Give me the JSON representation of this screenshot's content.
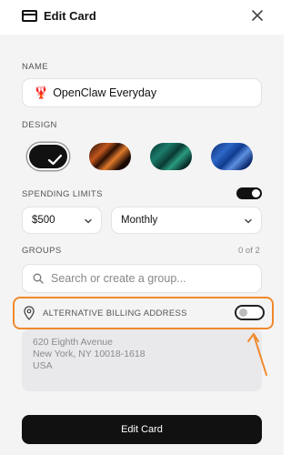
{
  "header": {
    "title": "Edit Card"
  },
  "name_section": {
    "label": "NAME",
    "value": "OpenClaw Everyday",
    "emoji": "🦞"
  },
  "design_section": {
    "label": "DESIGN",
    "swatches": [
      {
        "name": "black",
        "colors": [
          "#111111"
        ],
        "selected": true
      },
      {
        "name": "copper",
        "colors": [
          "#1a0904",
          "#c2561d",
          "#e07a2b"
        ],
        "selected": false
      },
      {
        "name": "emerald",
        "colors": [
          "#06302c",
          "#1b7c6a",
          "#2a9a7f"
        ],
        "selected": false
      },
      {
        "name": "sapphire",
        "colors": [
          "#0b2a6e",
          "#2f67c7",
          "#5d8fe0"
        ],
        "selected": false
      }
    ]
  },
  "spending_section": {
    "label": "SPENDING LIMITS",
    "enabled": true,
    "amount": "$500",
    "period": "Monthly"
  },
  "groups_section": {
    "label": "GROUPS",
    "count": "0 of 2",
    "search_placeholder": "Search or create a group..."
  },
  "billing_section": {
    "label": "ALTERNATIVE BILLING ADDRESS",
    "enabled": false,
    "address_lines": [
      "620 Eighth Avenue",
      "New York, NY 10018-1618",
      "USA"
    ]
  },
  "footer": {
    "submit_label": "Edit Card"
  },
  "colors": {
    "accent": "#f0892c",
    "primary": "#111111",
    "background": "#f4f4f5"
  }
}
